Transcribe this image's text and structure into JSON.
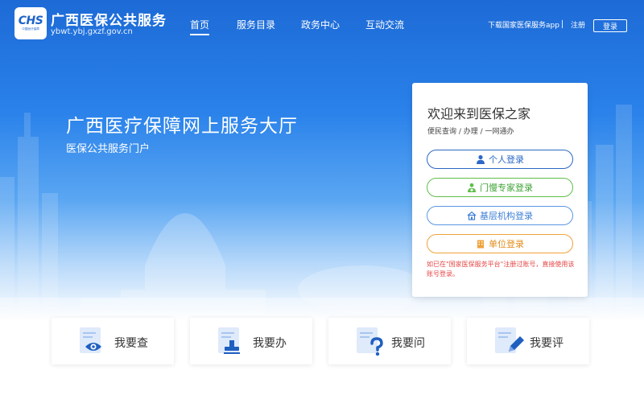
{
  "header": {
    "logo_mark": "CHS",
    "logo_sub": "中国医疗保障",
    "title": "广西医保公共服务",
    "domain": "ybwt.ybj.gxzf.gov.cn"
  },
  "nav": [
    {
      "label": "首页",
      "active": true
    },
    {
      "label": "服务目录",
      "active": false
    },
    {
      "label": "政务中心",
      "active": false
    },
    {
      "label": "互动交流",
      "active": false
    }
  ],
  "top_right": {
    "download_app": "下载国家医保服务app",
    "register": "注册",
    "login": "登录"
  },
  "hero": {
    "title": "广西医疗保障网上服务大厅",
    "subtitle": "医保公共服务门户"
  },
  "login_card": {
    "title": "欢迎来到医保之家",
    "subtitle": "便民查询 / 办理 / 一网通办",
    "buttons": {
      "personal": "个人登录",
      "expert": "门慢专家登录",
      "org": "基层机构登录",
      "unit": "单位登录"
    },
    "note": "如已在\"国家医保服务平台\"注册过账号，直接使用该账号登录。"
  },
  "services": [
    {
      "label": "我要查",
      "icon": "eye-icon"
    },
    {
      "label": "我要办",
      "icon": "stamp-icon"
    },
    {
      "label": "我要问",
      "icon": "question-icon"
    },
    {
      "label": "我要评",
      "icon": "pen-icon"
    }
  ],
  "colors": {
    "primary": "#1d63c9",
    "personal": "#2b67c5",
    "expert": "#5fbf4a",
    "org": "#5a96e2",
    "unit": "#f0a23a",
    "note": "#e64545"
  }
}
